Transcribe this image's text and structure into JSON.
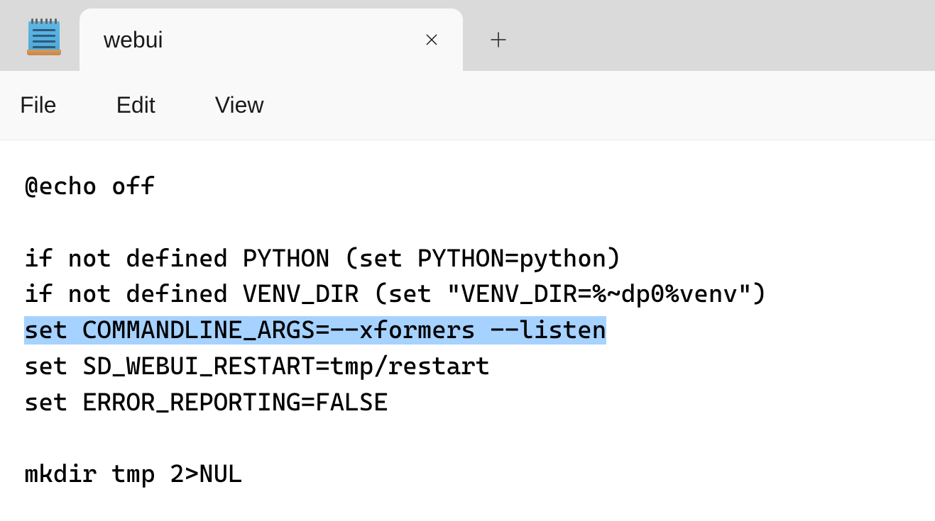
{
  "tab": {
    "title": "webui"
  },
  "menu": {
    "file": "File",
    "edit": "Edit",
    "view": "View"
  },
  "content": {
    "lines": [
      "@echo off",
      "",
      "if not defined PYTHON (set PYTHON=python)",
      "if not defined VENV_DIR (set \"VENV_DIR=%~dp0%venv\")",
      "set COMMANDLINE_ARGS=--xformers --listen",
      "set SD_WEBUI_RESTART=tmp/restart",
      "set ERROR_REPORTING=FALSE",
      "",
      "mkdir tmp 2>NUL"
    ],
    "highlighted_line_index": 4
  }
}
